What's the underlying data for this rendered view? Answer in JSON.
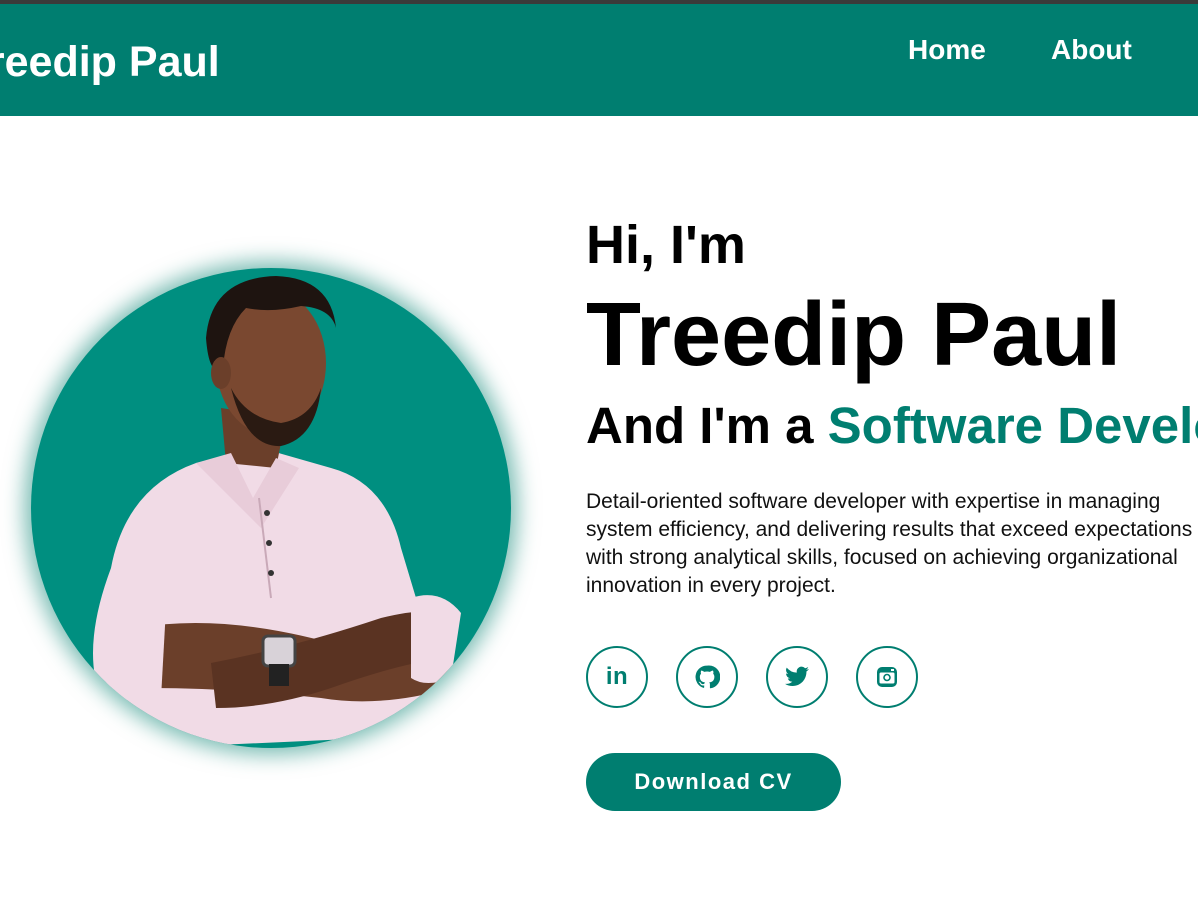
{
  "navbar": {
    "brand": "Treedip Paul",
    "links": [
      {
        "label": "Home"
      },
      {
        "label": "About"
      }
    ]
  },
  "hero": {
    "greeting": "Hi, I'm",
    "name": "Treedip Paul",
    "role_prefix": "And I'm a ",
    "role_highlight": "Software Developer",
    "description_lines": [
      "Detail-oriented software developer with expertise in managing",
      "system efficiency, and delivering results that exceed expectations",
      "with strong analytical skills, focused on achieving organizational",
      "innovation in every project."
    ],
    "socials": [
      {
        "name": "linkedin",
        "icon": "linkedin-icon",
        "glyph": "in"
      },
      {
        "name": "github",
        "icon": "github-icon"
      },
      {
        "name": "twitter",
        "icon": "twitter-icon"
      },
      {
        "name": "instagram",
        "icon": "instagram-icon"
      }
    ],
    "cta_label": "Download CV"
  },
  "colors": {
    "accent": "#007e70",
    "photo_bg": "#008f80",
    "nav_text": "#ffffff"
  }
}
